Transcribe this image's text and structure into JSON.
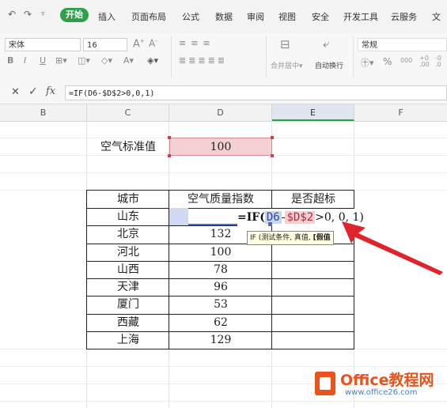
{
  "menu": {
    "tabs": [
      "开始",
      "插入",
      "页面布局",
      "公式",
      "数据",
      "审阅",
      "视图",
      "安全",
      "开发工具",
      "云服务",
      "文"
    ]
  },
  "ribbon": {
    "font_name": "宋体",
    "font_size": "16",
    "merge_label": "合并居中",
    "wrap_label": "自动换行",
    "number_format": "常规",
    "percent": "%",
    "thousands": "000"
  },
  "formula_bar": {
    "cancel": "✕",
    "confirm": "✓",
    "fx": "fx",
    "formula": "=IF(D6-$D$2>0,0,1)"
  },
  "columns": [
    "B",
    "C",
    "D",
    "E",
    "F"
  ],
  "sheet": {
    "std_label": "空气标准值",
    "std_value": "100",
    "headers": [
      "城市",
      "空气质量指数",
      "是否超标"
    ],
    "rows": [
      {
        "city": "山东",
        "aqi": ""
      },
      {
        "city": "北京",
        "aqi": "132"
      },
      {
        "city": "河北",
        "aqi": "100"
      },
      {
        "city": "山西",
        "aqi": "78"
      },
      {
        "city": "天津",
        "aqi": "96"
      },
      {
        "city": "厦门",
        "aqi": "53"
      },
      {
        "city": "西藏",
        "aqi": "62"
      },
      {
        "city": "上海",
        "aqi": "129"
      }
    ],
    "edit_formula": {
      "prefix": "=IF(",
      "ref1": "D6",
      "minus": "-",
      "ref2": "$D$2",
      "suffix": ">0, 0, 1)"
    },
    "tooltip": {
      "text": "IF (测试条件, 真值, ",
      "bold": "[假值"
    }
  },
  "watermark": {
    "brand": "Office教程网",
    "url": "www.office26.com"
  },
  "colors": {
    "accent": "#2fa04a",
    "arrow": "#e0242b",
    "highlight": "#f4d0d3",
    "ref_blue": "#c9d6f0"
  }
}
